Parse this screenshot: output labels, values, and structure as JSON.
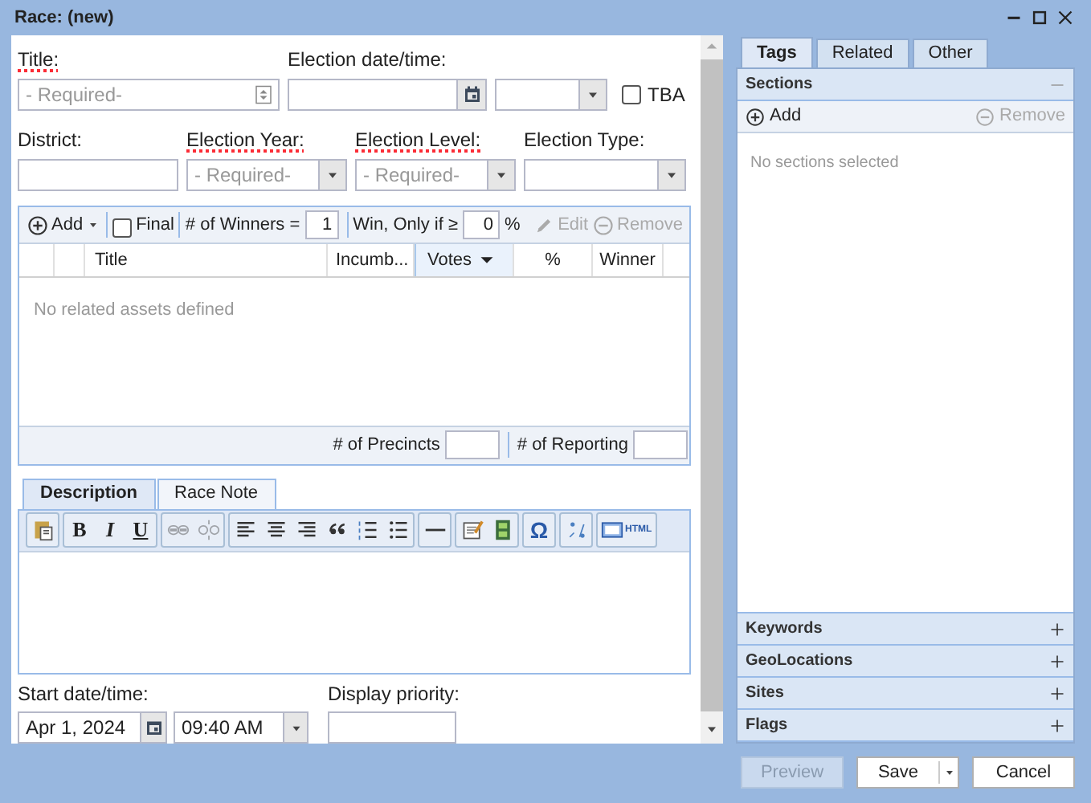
{
  "window": {
    "title": "Race: (new)"
  },
  "form": {
    "title": {
      "label": "Title:",
      "placeholder": "- Required-",
      "required": true
    },
    "election_datetime": {
      "label": "Election date/time:",
      "required": false
    },
    "tba": {
      "label": "TBA",
      "checked": false
    },
    "district": {
      "label": "District:",
      "required": false
    },
    "election_year": {
      "label": "Election Year:",
      "placeholder": "- Required-",
      "required": true
    },
    "election_level": {
      "label": "Election Level:",
      "placeholder": "- Required-",
      "required": true
    },
    "election_type": {
      "label": "Election Type:",
      "required": false
    }
  },
  "candidates": {
    "toolbar": {
      "add": "Add",
      "final": {
        "label": "Final",
        "checked": false
      },
      "winners": {
        "label": "# of Winners =",
        "value": "1"
      },
      "threshold": {
        "label": "Win, Only if ≥",
        "value": "0",
        "unit": "%"
      },
      "edit": {
        "label": "Edit",
        "disabled": true
      },
      "remove": {
        "label": "Remove",
        "disabled": true
      }
    },
    "columns": [
      {
        "label": "Title",
        "sorted": false
      },
      {
        "label": "Incumb...",
        "sorted": false
      },
      {
        "label": "Votes",
        "sorted": true
      },
      {
        "label": "%",
        "sorted": false
      },
      {
        "label": "Winner",
        "sorted": false
      }
    ],
    "empty_text": "No related assets defined",
    "precincts": {
      "label": "# of Precincts"
    },
    "reporting": {
      "label": "# of Reporting"
    }
  },
  "editor": {
    "tabs": [
      {
        "label": "Description",
        "selected": true
      },
      {
        "label": "Race Note",
        "selected": false
      }
    ],
    "toolbar": [
      [
        {
          "kind": "paste",
          "disabled": false
        }
      ],
      [
        {
          "kind": "bold",
          "text": "B",
          "disabled": false
        },
        {
          "kind": "italic",
          "text": "I",
          "disabled": false
        },
        {
          "kind": "underline",
          "text": "U",
          "disabled": false
        }
      ],
      [
        {
          "kind": "link",
          "disabled": true
        },
        {
          "kind": "unlink",
          "disabled": true
        }
      ],
      [
        {
          "kind": "align-left",
          "disabled": false
        },
        {
          "kind": "align-center",
          "disabled": false
        },
        {
          "kind": "align-right",
          "disabled": false
        },
        {
          "kind": "quote",
          "disabled": false
        },
        {
          "kind": "ordered-list",
          "disabled": false
        },
        {
          "kind": "bullet-list",
          "disabled": false
        }
      ],
      [
        {
          "kind": "rule",
          "disabled": false
        }
      ],
      [
        {
          "kind": "note",
          "disabled": false
        },
        {
          "kind": "media",
          "disabled": false
        }
      ],
      [
        {
          "kind": "symbol",
          "text": "Ω",
          "disabled": false
        }
      ],
      [
        {
          "kind": "spellcheck",
          "disabled": false
        }
      ],
      [
        {
          "kind": "source",
          "text": "HTML",
          "disabled": false
        }
      ]
    ]
  },
  "schedule": {
    "start": {
      "label": "Start date/time:",
      "date": "Apr 1, 2024",
      "time": "09:40 AM"
    },
    "priority": {
      "label": "Display priority:"
    }
  },
  "side": {
    "tabs": [
      {
        "label": "Tags",
        "selected": true
      },
      {
        "label": "Related",
        "selected": false
      },
      {
        "label": "Other",
        "selected": false
      }
    ],
    "panels": [
      {
        "title": "Sections",
        "expanded": true,
        "add": "Add",
        "remove": {
          "label": "Remove",
          "disabled": true
        },
        "empty_text": "No sections selected"
      },
      {
        "title": "Keywords",
        "expanded": false
      },
      {
        "title": "GeoLocations",
        "expanded": false
      },
      {
        "title": "Sites",
        "expanded": false
      },
      {
        "title": "Flags",
        "expanded": false
      }
    ]
  },
  "buttons": [
    {
      "label": "Preview",
      "disabled": true,
      "split": false
    },
    {
      "label": "Save",
      "disabled": false,
      "split": true
    },
    {
      "label": "Cancel",
      "disabled": false,
      "split": false
    }
  ]
}
